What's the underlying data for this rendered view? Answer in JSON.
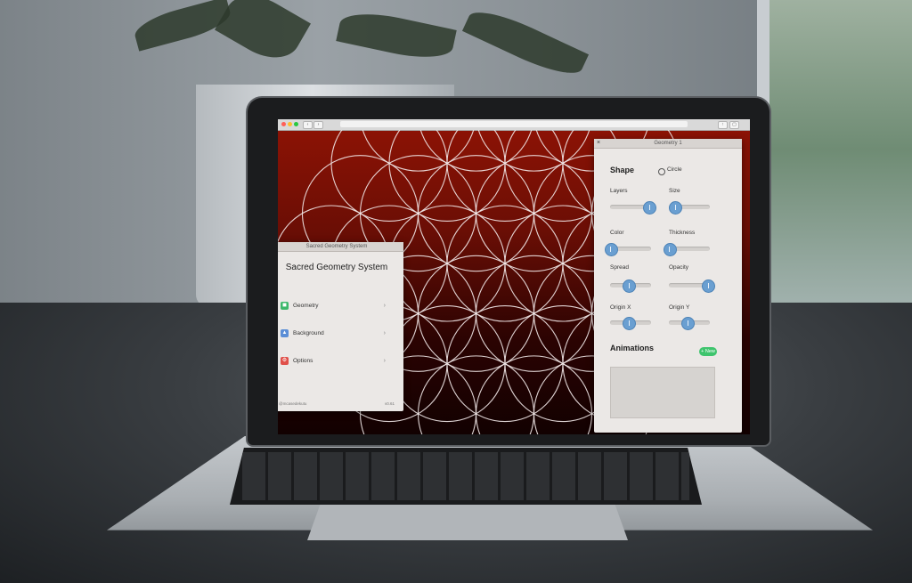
{
  "app_panel": {
    "titlebar": "Sacred Geometry System",
    "heading": "Sacred Geometry System",
    "close_glyph": "×",
    "menu": [
      {
        "label": "Geometry",
        "icon": "geometry-icon",
        "color": "#3db86b"
      },
      {
        "label": "Background",
        "icon": "image-icon",
        "color": "#5b8ed6"
      },
      {
        "label": "Options",
        "icon": "options-icon",
        "color": "#e0504a"
      }
    ],
    "chevron": "›",
    "footer_left": "@mcasedekutu",
    "footer_right": "v0.61"
  },
  "geometry_panel": {
    "titlebar": "Geometry 1",
    "close_glyph": "×",
    "shape_label": "Shape",
    "shape_option": "Circle",
    "controls": [
      {
        "label": "Layers",
        "value": 0.95
      },
      {
        "label": "Size",
        "value": 0.15
      },
      {
        "label": "Color",
        "value": 0.0
      },
      {
        "label": "Thickness",
        "value": 0.0
      },
      {
        "label": "Spread",
        "value": 0.45
      },
      {
        "label": "Opacity",
        "value": 0.95
      },
      {
        "label": "Origin X",
        "value": 0.45
      },
      {
        "label": "Origin Y",
        "value": 0.45
      }
    ],
    "animations_label": "Animations",
    "new_button": "+ New"
  },
  "colors": {
    "accent_blue": "#6a9fd1",
    "new_green": "#3ec46d",
    "canvas_red": "#8f1305"
  }
}
